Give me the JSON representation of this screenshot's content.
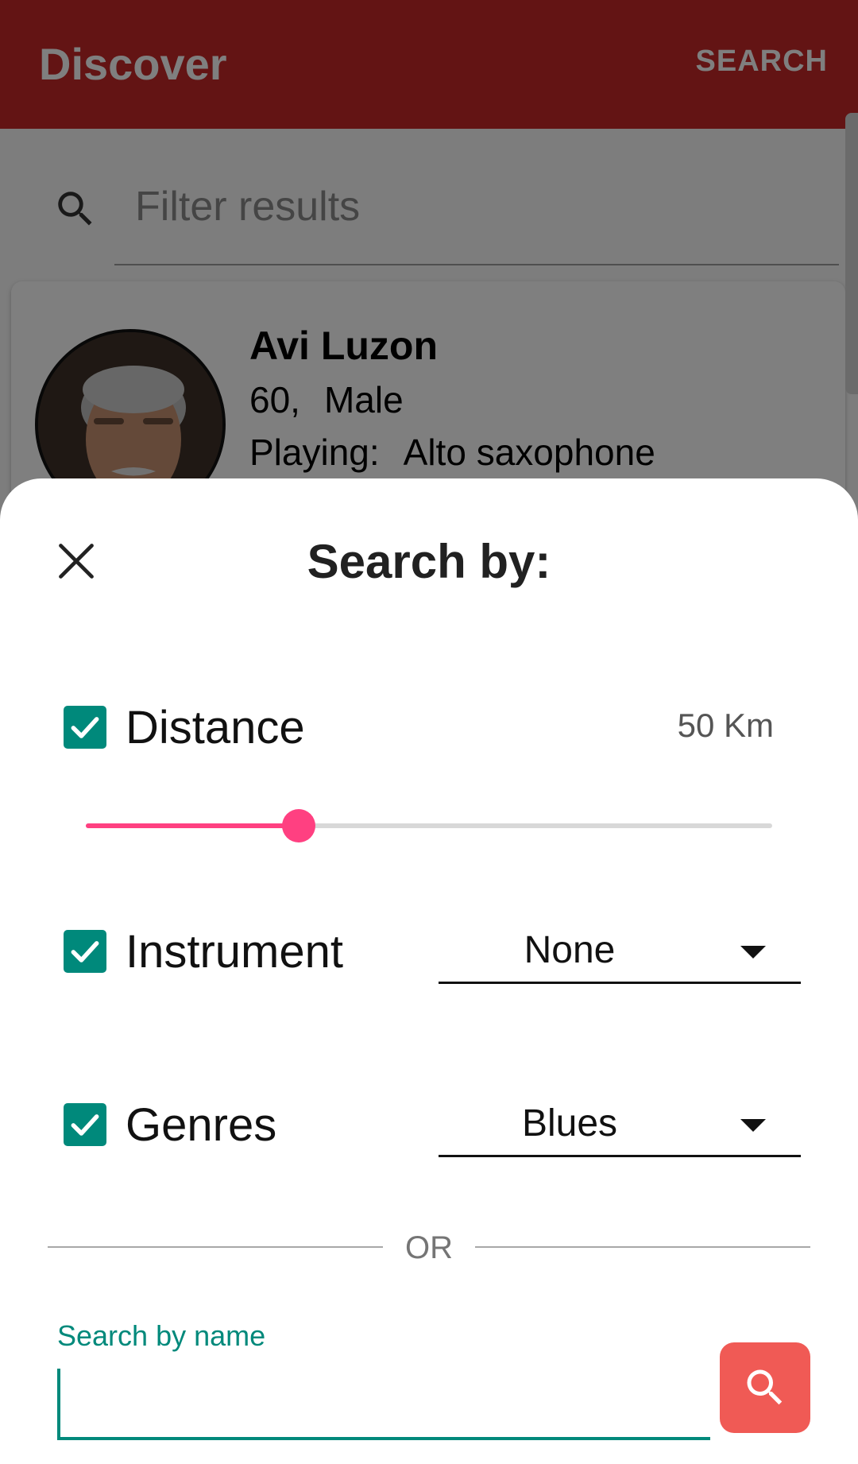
{
  "app_bar": {
    "title": "Discover",
    "action_label": "SEARCH",
    "color": "#c62828"
  },
  "filter": {
    "placeholder": "Filter results",
    "icon": "search-icon"
  },
  "result_card": {
    "name": "Avi Luzon",
    "age": "60,",
    "gender": "Male",
    "playing_label": "Playing:",
    "instrument": "Alto saxophone",
    "avatar_icon": "profile-photo"
  },
  "sheet": {
    "title": "Search by:",
    "close_icon": "close-icon",
    "distance": {
      "label": "Distance",
      "checked": true,
      "value_text": "50 Km",
      "slider_fraction": 0.31,
      "slider_color": "#ff4081"
    },
    "instrument": {
      "label": "Instrument",
      "checked": true,
      "selected": "None"
    },
    "genres": {
      "label": "Genres",
      "checked": true,
      "selected": "Blues"
    },
    "divider_text": "OR",
    "name_search": {
      "label": "Search by name",
      "value": "",
      "accent_color": "#00897b"
    },
    "search_button": {
      "icon": "search-icon",
      "color": "#f05a55"
    }
  }
}
